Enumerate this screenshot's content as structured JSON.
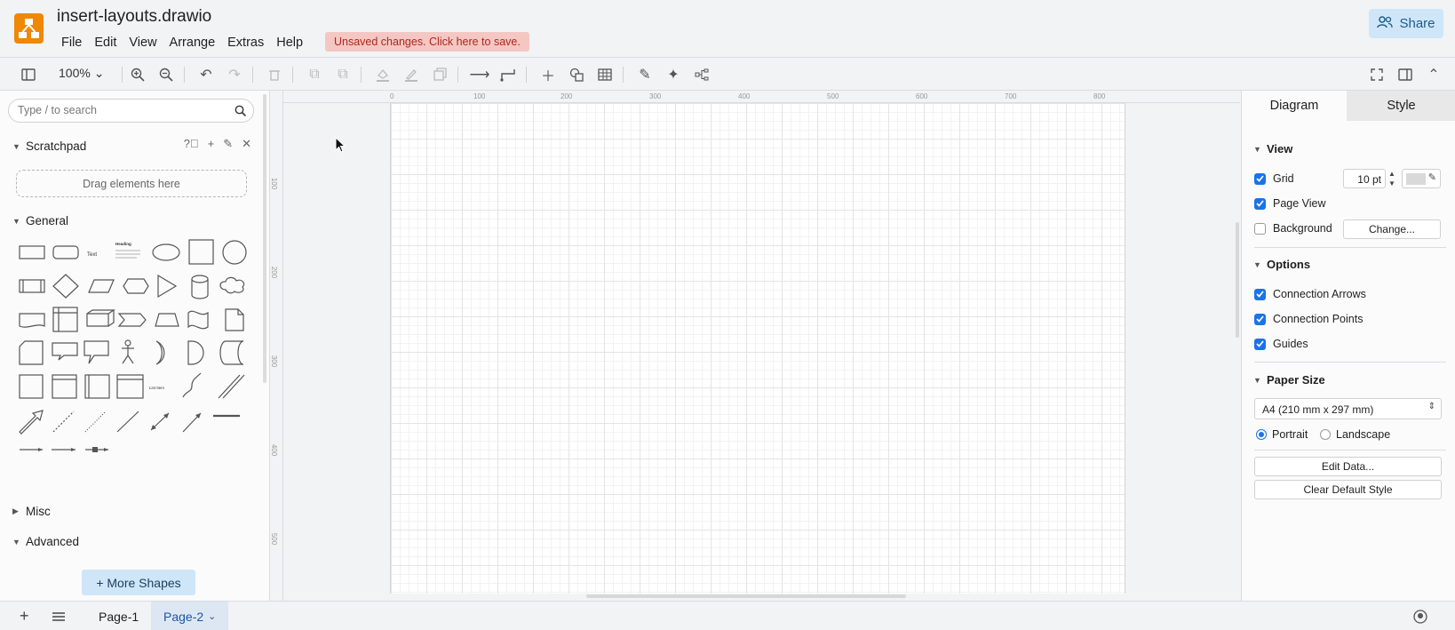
{
  "header": {
    "title": "insert-layouts.drawio",
    "menu": [
      "File",
      "Edit",
      "View",
      "Arrange",
      "Extras",
      "Help"
    ],
    "unsaved_notice": "Unsaved changes. Click here to save.",
    "share_label": "Share"
  },
  "toolbar": {
    "zoom": "100%"
  },
  "sidebar": {
    "search_placeholder": "Type / to search",
    "scratchpad": "Scratchpad",
    "drop_hint": "Drag elements here",
    "general": "General",
    "misc": "Misc",
    "advanced": "Advanced",
    "more_shapes": "+ More Shapes",
    "shape_text": "Text",
    "shape_heading": "Heading",
    "shape_list_item": "List Item"
  },
  "ruler": {
    "top": [
      "0",
      "100",
      "200",
      "300",
      "400",
      "500",
      "600",
      "700",
      "800"
    ],
    "left": [
      "100",
      "200",
      "300",
      "400",
      "500"
    ]
  },
  "format_panel": {
    "tabs": [
      "Diagram",
      "Style"
    ],
    "view_title": "View",
    "grid_label": "Grid",
    "grid_size": "10 pt",
    "page_view_label": "Page View",
    "background_label": "Background",
    "change_button": "Change...",
    "options_title": "Options",
    "connection_arrows": "Connection Arrows",
    "connection_points": "Connection Points",
    "guides": "Guides",
    "paper_size_title": "Paper Size",
    "paper_size_value": "A4 (210 mm x 297 mm)",
    "portrait": "Portrait",
    "landscape": "Landscape",
    "edit_data": "Edit Data...",
    "clear_style": "Clear Default Style",
    "grid_checked": true,
    "page_view_checked": true,
    "background_checked": false,
    "orientation": "Portrait"
  },
  "footer": {
    "pages": [
      "Page-1",
      "Page-2"
    ],
    "active_page": "Page-2"
  },
  "colors": {
    "accent": "#1a73e8",
    "logo": "#f08705",
    "share_bg": "#cfe6f8",
    "unsaved_bg": "#f4c7c3"
  }
}
